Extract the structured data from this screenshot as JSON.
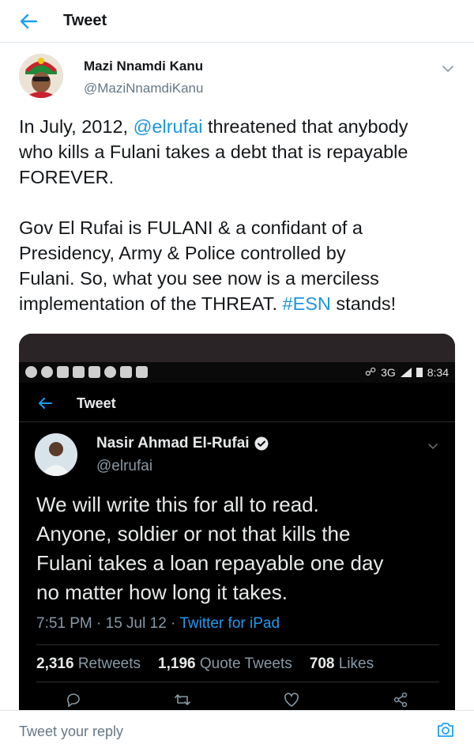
{
  "header": {
    "title": "Tweet"
  },
  "tweet": {
    "author_name": "Mazi Nnamdi Kanu",
    "author_handle": "@MaziNnamdiKanu",
    "lines": [
      {
        "parts": [
          {
            "t": "In July, 2012, "
          },
          {
            "t": "@elrufai",
            "link": true
          },
          {
            "t": " threatened that anybody"
          }
        ]
      },
      {
        "parts": [
          {
            "t": "who kills a Fulani takes a debt that is repayable"
          }
        ]
      },
      {
        "parts": [
          {
            "t": "FOREVER."
          }
        ]
      },
      {
        "gap": true
      },
      {
        "parts": [
          {
            "t": "Gov El Rufai is FULANI & a confidant of a"
          }
        ]
      },
      {
        "parts": [
          {
            "t": "Presidency, Army & Police controlled by"
          }
        ]
      },
      {
        "parts": [
          {
            "t": "Fulani. So, what you see now is a merciless"
          }
        ]
      },
      {
        "parts": [
          {
            "t": "implementation of the THREAT. "
          },
          {
            "t": "#ESN",
            "link": true
          },
          {
            "t": " stands!"
          }
        ]
      }
    ]
  },
  "embedded": {
    "status_bar": {
      "network": "3G",
      "time": "8:34"
    },
    "header_title": "Tweet",
    "author_name": "Nasir Ahmad El-Rufai",
    "author_handle": "@elrufai",
    "lines": [
      "We will write this for all to read.",
      "Anyone, soldier or not that kills the",
      "Fulani takes a loan repayable one day",
      "no matter how long it takes."
    ],
    "timestamp": "7:51 PM · 15 Jul 12 · ",
    "source": "Twitter for iPad",
    "retweets_count": "2,316",
    "retweets_label": "Retweets",
    "quotes_count": "1,196",
    "quotes_label": "Quote Tweets",
    "likes_count": "708",
    "likes_label": "Likes"
  },
  "reply": {
    "placeholder": "Tweet your reply"
  },
  "colors": {
    "link": "#1b95e0",
    "text": "#14171a",
    "muted": "#657786",
    "dark_bg": "#000000"
  },
  "icons": [
    "back-arrow-icon",
    "chevron-down-icon",
    "verified-icon",
    "reply-icon",
    "retweet-icon",
    "like-icon",
    "share-icon",
    "camera-icon"
  ]
}
